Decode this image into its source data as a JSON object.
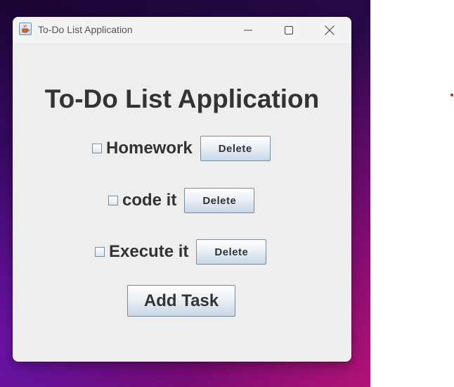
{
  "window": {
    "title": "To-Do List Application"
  },
  "app": {
    "heading": "To-Do List Application",
    "tasks": [
      {
        "label": "Homework",
        "checked": false,
        "delete_label": "Delete"
      },
      {
        "label": "code it",
        "checked": false,
        "delete_label": "Delete"
      },
      {
        "label": "Execute it",
        "checked": false,
        "delete_label": "Delete"
      }
    ],
    "add_label": "Add Task"
  },
  "colors": {
    "window_bg": "#eeeeee",
    "text": "#333333",
    "button_gradient_bottom": "#c8d7e6"
  },
  "icons": {
    "app": "java-coffee-cup-icon",
    "minimize": "minimize-icon",
    "maximize": "maximize-icon",
    "close": "close-icon"
  }
}
